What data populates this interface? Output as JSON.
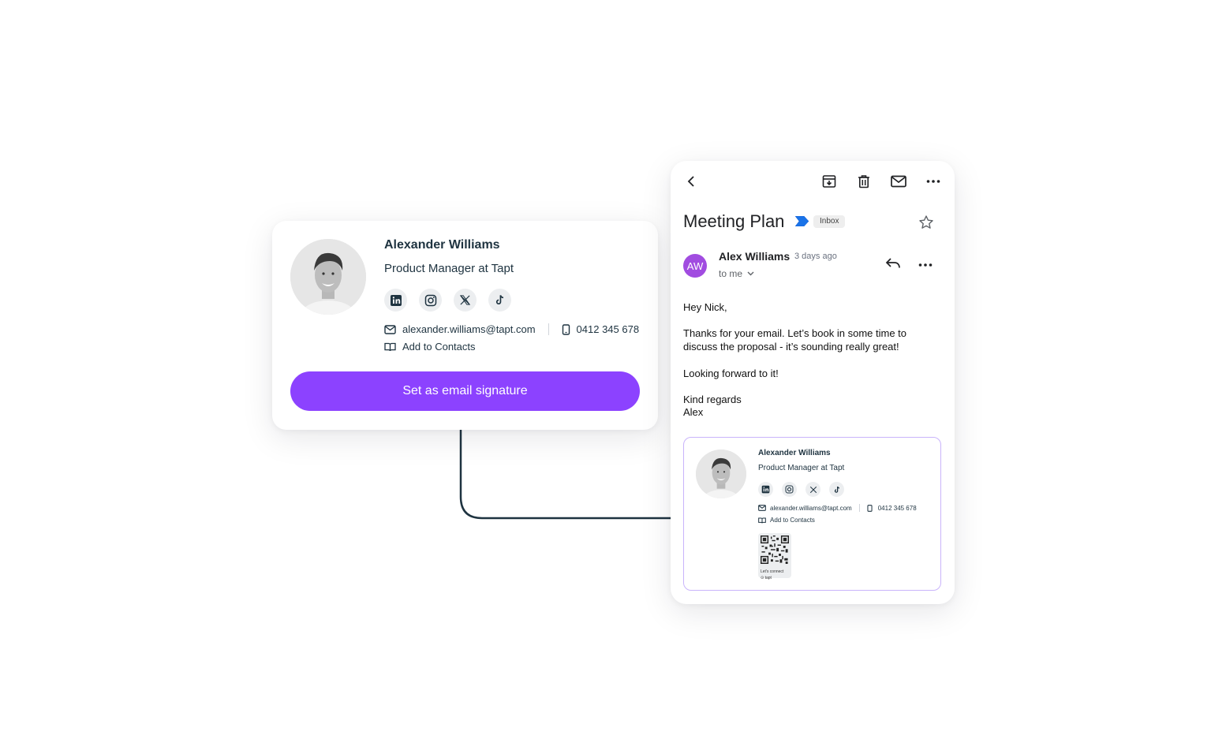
{
  "signature_card": {
    "name": "Alexander Williams",
    "role": "Product Manager at Tapt",
    "social": [
      "linkedin-icon",
      "instagram-icon",
      "x-icon",
      "tiktok-icon"
    ],
    "email": "alexander.williams@tapt.com",
    "phone": "0412 345 678",
    "add_contacts": "Add to Contacts",
    "cta_label": "Set as email signature"
  },
  "email": {
    "toolbar": [
      "back-icon",
      "archive-icon",
      "delete-icon",
      "mail-icon",
      "more-icon"
    ],
    "subject": "Meeting Plan",
    "label": "Inbox",
    "sender_initials": "AW",
    "sender_name": "Alex Williams",
    "time": "3 days ago",
    "recipient": "to me",
    "body": {
      "greeting": "Hey Nick,",
      "line1": "Thanks for your email. Let’s book in some time to",
      "line2": "discuss the proposal - it’s sounding really great!",
      "line3": "Looking forward to it!",
      "signoff": "Kind regards",
      "signer": "Alex"
    },
    "mini_signature": {
      "name": "Alexander Williams",
      "role": "Product Manager at Tapt",
      "email": "alexander.williams@tapt.com",
      "phone": "0412 345 678",
      "add_contacts": "Add to Contacts",
      "qr_caption_1": "Let's connect",
      "qr_caption_2": "⊙ tapt"
    }
  },
  "colors": {
    "accent": "#8c42ff",
    "connector": "#1e3340",
    "sender_avatar": "#a14ce0",
    "label_blue": "#1a73e8"
  }
}
